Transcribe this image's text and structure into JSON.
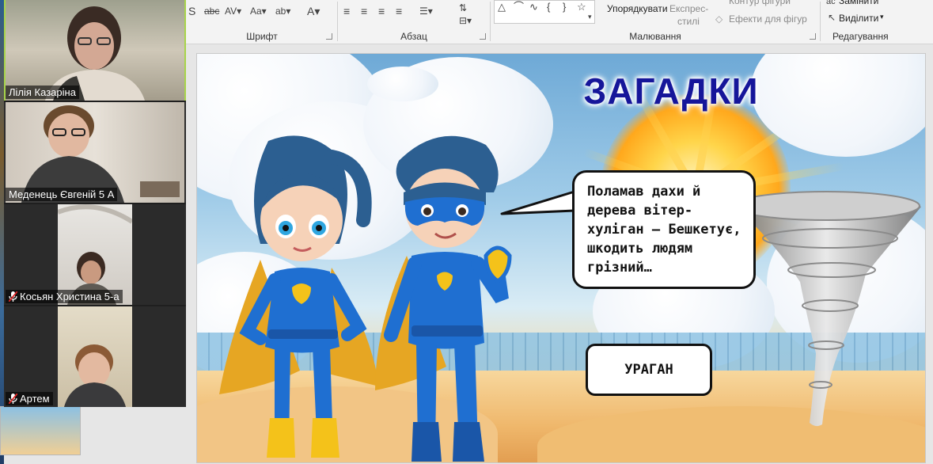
{
  "ribbon": {
    "font_group_label": "Шрифт",
    "paragraph_group_label": "Абзац",
    "drawing_group_label": "Малювання",
    "editing_group_label": "Редагування",
    "arrange_label": "Упорядкувати",
    "quick_styles_label": "Експрес-",
    "quick_styles_label_2": "стилі",
    "shape_outline_label": "Контур фігури",
    "shape_effects_label": "Ефекти для фігур",
    "replace_label": "Замінити",
    "select_label": "Виділити"
  },
  "participants": [
    {
      "name": "Лілія Казаріна",
      "muted": false,
      "active": true
    },
    {
      "name": "Меденець Євгеній 5 А",
      "muted": false,
      "active": false
    },
    {
      "name": "Косьян Христина 5-а",
      "muted": true,
      "active": false
    },
    {
      "name": "Артем",
      "muted": true,
      "active": false
    }
  ],
  "slide": {
    "title": "ЗАГАДКИ",
    "riddle": "Поламав дахи й дерева вітер-хуліган – Бешкетує, шкодить людям грізний…",
    "answer": "УРАГАН"
  },
  "colors": {
    "title": "#16169a",
    "active_speaker_border": "#a8d44a",
    "hero_suit": "#1f6fd1",
    "hero_accent": "#f4c21a"
  },
  "icons": {
    "mic_muted": "mic-muted-icon",
    "sun": "sun-icon",
    "tornado": "tornado-icon",
    "heart": "heart-icon"
  }
}
